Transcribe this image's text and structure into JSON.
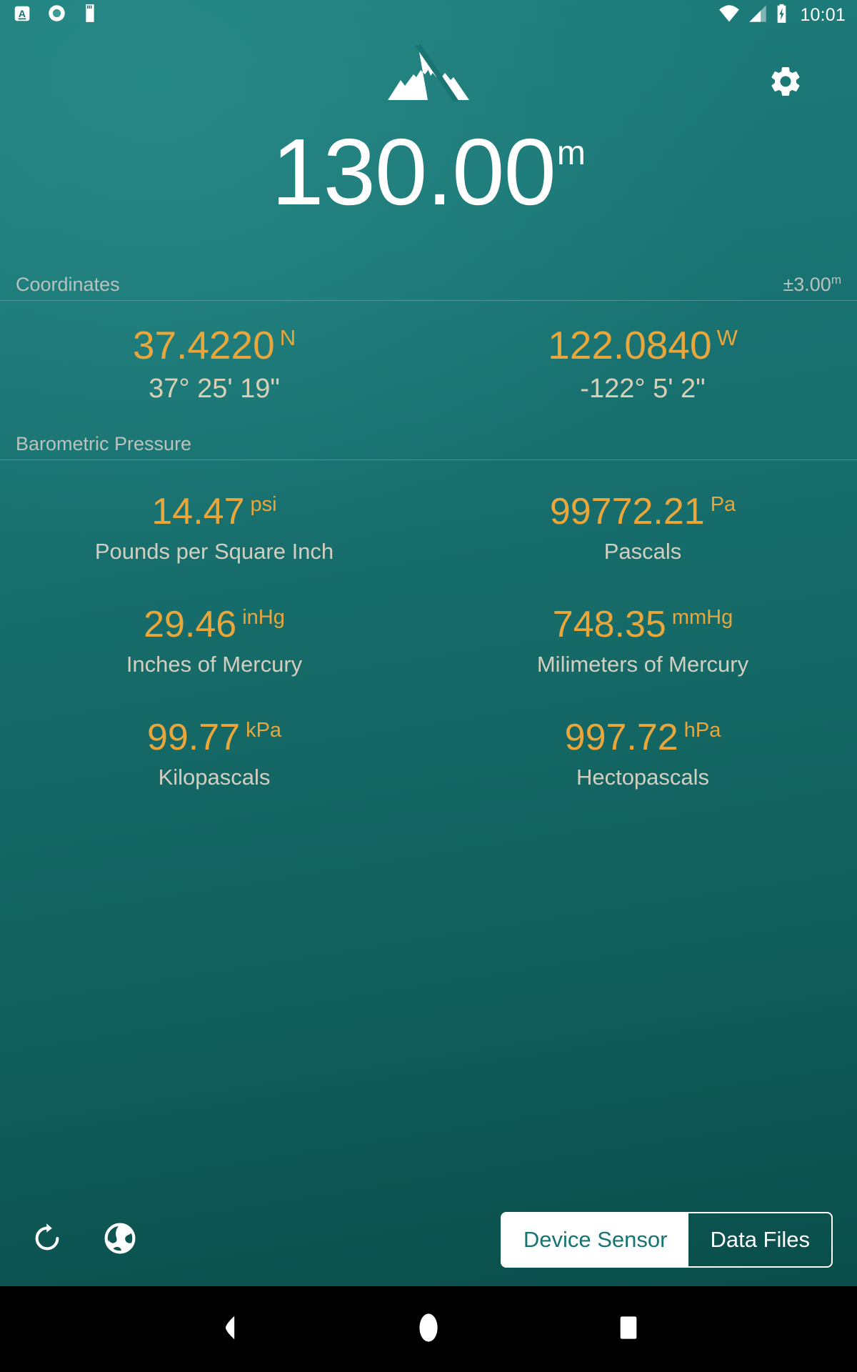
{
  "colors": {
    "background_top": "#1d7d7b",
    "background_bottom": "#084a47",
    "accent_value": "#e9a63b",
    "label": "#d2cfc0",
    "section_label": "#b9c3bd",
    "white": "#ffffff",
    "navbar": "#000000"
  },
  "statusbar": {
    "notification_icons": [
      "keyboard-a-icon",
      "record-disc-icon",
      "sd-card-icon"
    ],
    "system_icons": [
      "wifi-icon",
      "cellular-signal-icon",
      "battery-charging-icon"
    ],
    "time": "10:01"
  },
  "header": {
    "logo_icon": "mountain-logo-icon",
    "settings_icon": "gear-icon"
  },
  "altitude": {
    "value": "130.00",
    "unit": "m"
  },
  "coordinates_section": {
    "title": "Coordinates",
    "accuracy_value": "±3.00",
    "accuracy_unit": "m",
    "cells": [
      {
        "value": "37.4220",
        "hemisphere": "N",
        "dms": "37° 25' 19\""
      },
      {
        "value": "122.0840",
        "hemisphere": "W",
        "dms": "-122° 5' 2\""
      }
    ]
  },
  "barometric_section": {
    "title": "Barometric Pressure",
    "cells": [
      {
        "value": "14.47",
        "unit": "psi",
        "label": "Pounds per Square Inch"
      },
      {
        "value": "99772.21",
        "unit": "Pa",
        "label": "Pascals"
      },
      {
        "value": "29.46",
        "unit": "inHg",
        "label": "Inches of Mercury"
      },
      {
        "value": "748.35",
        "unit": "mmHg",
        "label": "Milimeters of Mercury"
      },
      {
        "value": "99.77",
        "unit": "kPa",
        "label": "Kilopascals"
      },
      {
        "value": "997.72",
        "unit": "hPa",
        "label": "Hectopascals"
      }
    ]
  },
  "bottom_bar": {
    "refresh_icon": "refresh-icon",
    "globe_icon": "globe-icon",
    "segments": [
      {
        "label": "Device Sensor",
        "selected": true
      },
      {
        "label": "Data Files",
        "selected": false
      }
    ]
  },
  "navbar": {
    "back_icon": "back-triangle-icon",
    "home_icon": "home-circle-icon",
    "recents_icon": "recents-square-icon"
  }
}
